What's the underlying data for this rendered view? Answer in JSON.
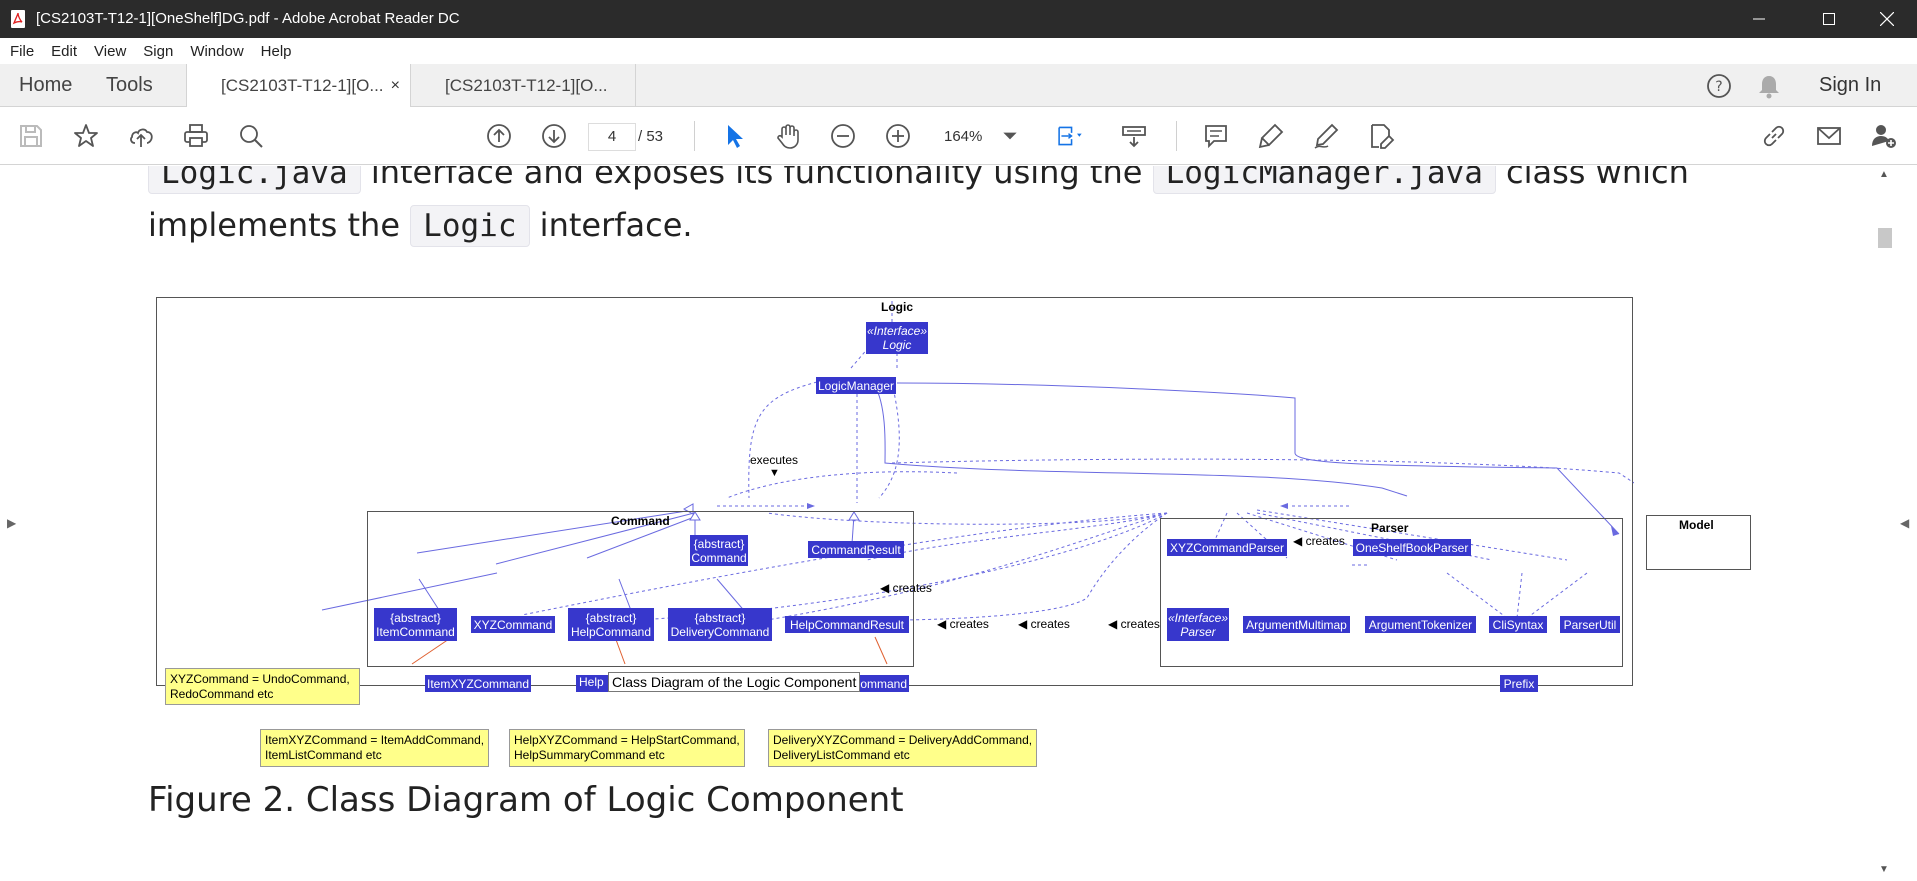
{
  "window": {
    "title": "[CS2103T-T12-1][OneShelf]DG.pdf - Adobe Acrobat Reader DC",
    "minimize": "—",
    "maximize": "☐",
    "close": "✕"
  },
  "menu": [
    "File",
    "Edit",
    "View",
    "Sign",
    "Window",
    "Help"
  ],
  "tabs": {
    "home": "Home",
    "tools": "Tools",
    "doc_tabs": [
      {
        "label": "[CS2103T-T12-1][O...",
        "active": true
      },
      {
        "label": "[CS2103T-T12-1][O...",
        "active": false
      }
    ],
    "close_glyph": "×",
    "sign_in": "Sign In"
  },
  "toolbar": {
    "page_current": "4",
    "page_total": "/ 53",
    "zoom": "164%"
  },
  "document": {
    "line1_code_a": "Logic.java",
    "line1_text_a": "interface and exposes its functionality using the",
    "line1_code_b": "LogicManager.java",
    "line1_text_b": "class which",
    "line2_text_a": "implements the",
    "line2_code": "Logic",
    "line2_text_b": "interface.",
    "caption": "Figure 2. Class Diagram of Logic Component"
  },
  "diagram": {
    "top_label": "Logic",
    "logic_interface": [
      "«Interface»",
      "Logic"
    ],
    "logic_manager": "LogicManager",
    "executes": "executes",
    "command_pkg": "Command",
    "parser_pkg": "Parser",
    "model_pkg": "Model",
    "abstract_command": [
      "{abstract}",
      "Command"
    ],
    "command_result": "CommandResult",
    "abstract_item": [
      "{abstract}",
      "ItemCommand"
    ],
    "xyz_command": "XYZCommand",
    "abstract_help": [
      "{abstract}",
      "HelpCommand"
    ],
    "abstract_delivery": [
      "{abstract}",
      "DeliveryCommand"
    ],
    "help_command_result": "HelpCommandResult",
    "item_xyz": "ItemXYZCommand",
    "help_xyz_partial": "Help",
    "delivery_xyz_partial": "ommand",
    "xyz_parser": "XYZCommandParser",
    "oneshelf_parser": "OneShelfBookParser",
    "interface_parser": [
      "«Interface»",
      "Parser"
    ],
    "argument_multimap": "ArgumentMultimap",
    "argument_tokenizer": "ArgumentTokenizer",
    "cli_syntax": "CliSyntax",
    "parser_util": "ParserUtil",
    "prefix": "Prefix",
    "creates": "◀ creates",
    "notes": {
      "xyz": [
        "XYZCommand = UndoCommand,",
        "RedoCommand etc"
      ],
      "item": [
        "ItemXYZCommand = ItemAddCommand,",
        "ItemListCommand etc"
      ],
      "help": [
        "HelpXYZCommand = HelpStartCommand,",
        "HelpSummaryCommand etc"
      ],
      "delivery": [
        "DeliveryXYZCommand = DeliveryAddCommand,",
        "DeliveryListCommand etc"
      ]
    },
    "tooltip": "Class Diagram of the Logic Component"
  },
  "colors": {
    "class_fill": "#3737cc",
    "note_fill": "#ffff8a",
    "titlebar": "#2b2b2b",
    "accent_blue": "#1473e6"
  }
}
